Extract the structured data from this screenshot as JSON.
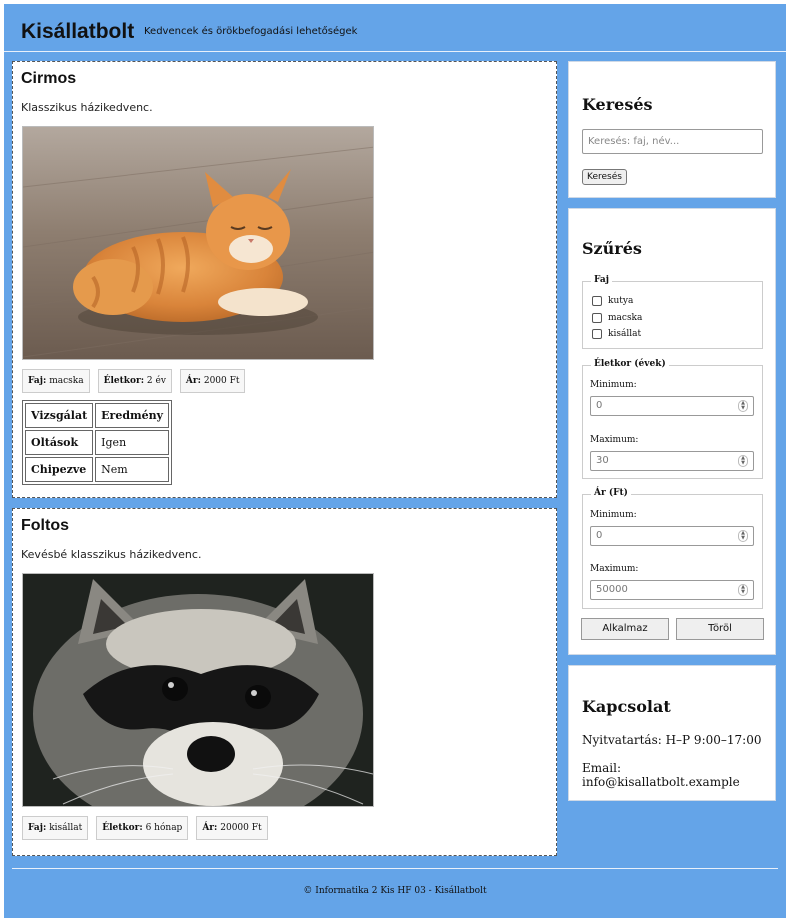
{
  "header": {
    "title": "Kisállatbolt",
    "tagline": "Kedvencek és örökbefogadási lehetőségek"
  },
  "pets": [
    {
      "name": "Cirmos",
      "description": "Klasszikus házikedvenc.",
      "photo": "orange-tabby-cat",
      "tags": [
        {
          "label": "Faj:",
          "value": "macska"
        },
        {
          "label": "Életkor:",
          "value": "2 év"
        },
        {
          "label": "Ár:",
          "value": "2000 Ft"
        }
      ],
      "table": {
        "headers": [
          "Vizsgálat",
          "Eredmény"
        ],
        "rows": [
          [
            "Oltások",
            "Igen"
          ],
          [
            "Chipezve",
            "Nem"
          ]
        ]
      }
    },
    {
      "name": "Foltos",
      "description": "Kevésbé klasszikus házikedvenc.",
      "photo": "raccoon",
      "tags": [
        {
          "label": "Faj:",
          "value": "kisállat"
        },
        {
          "label": "Életkor:",
          "value": "6 hónap"
        },
        {
          "label": "Ár:",
          "value": "20000 Ft"
        }
      ]
    }
  ],
  "search": {
    "title": "Keresés",
    "placeholder": "Keresés: faj, név...",
    "button": "Keresés"
  },
  "filter": {
    "title": "Szűrés",
    "species": {
      "legend": "Faj",
      "options": [
        "kutya",
        "macska",
        "kisállat"
      ]
    },
    "age": {
      "legend": "Életkor (évek)",
      "min_label": "Minimum:",
      "min_value": "0",
      "max_label": "Maximum:",
      "max_value": "30"
    },
    "price": {
      "legend": "Ár (Ft)",
      "min_label": "Minimum:",
      "min_value": "0",
      "max_label": "Maximum:",
      "max_value": "50000"
    },
    "apply_button": "Alkalmaz",
    "clear_button": "Töröl"
  },
  "contact": {
    "title": "Kapcsolat",
    "hours": "Nyitvatartás: H–P 9:00–17:00",
    "email": "Email: info@kisallatbolt.example"
  },
  "footer": {
    "text": "© Informatika 2 Kis HF 03 - Kisállatbolt"
  },
  "colors": {
    "page_background": "#64a4e8",
    "card_background": "#ffffff"
  }
}
